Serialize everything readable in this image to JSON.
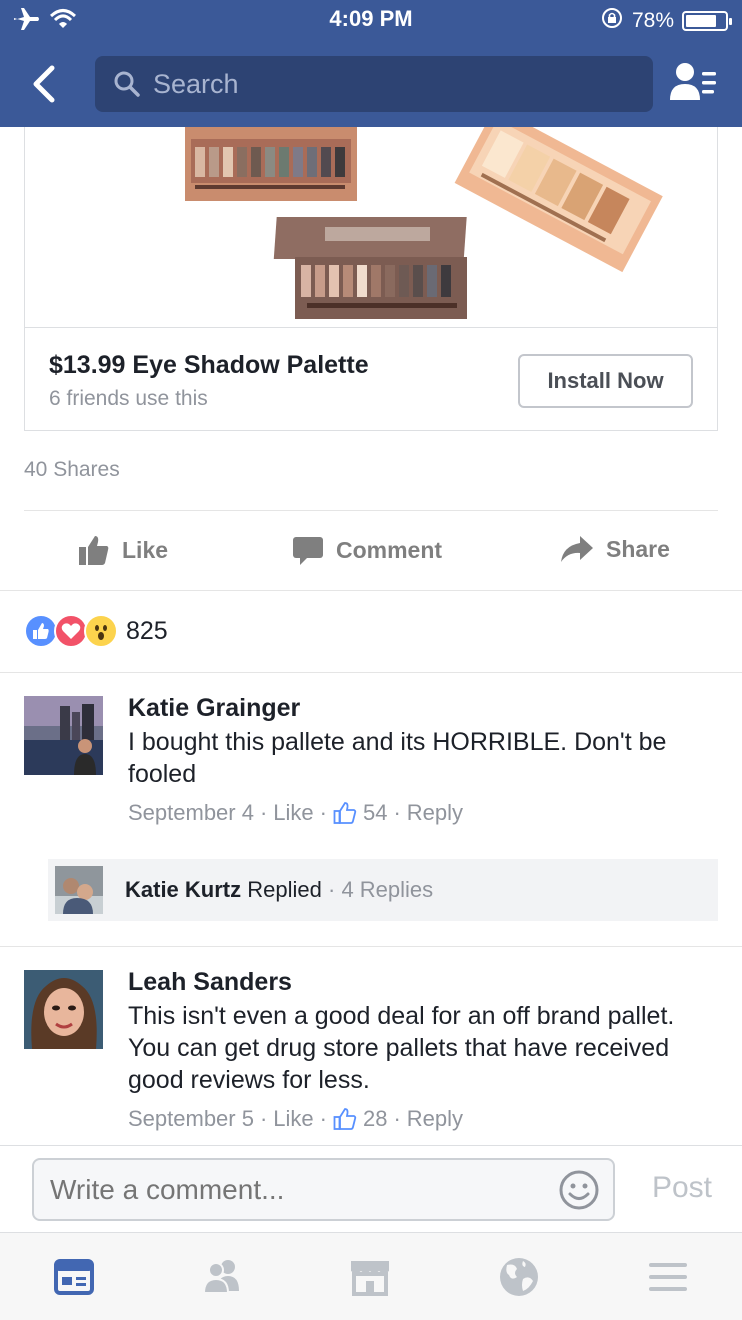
{
  "status_bar": {
    "time": "4:09 PM",
    "battery_percent": "78%",
    "battery_level": 0.78
  },
  "nav": {
    "search_placeholder": "Search"
  },
  "ad": {
    "title": "$13.99 Eye Shadow Palette",
    "subtitle": "6 friends use this",
    "install_label": "Install Now"
  },
  "post": {
    "shares": "40 Shares",
    "actions": {
      "like": "Like",
      "comment": "Comment",
      "share": "Share"
    },
    "reaction_count": "825"
  },
  "comments": [
    {
      "name": "Katie Grainger",
      "text": "I bought this pallete and its HORRIBLE. Don't be fooled",
      "date": "September 4",
      "like_label": "Like",
      "likes": "54",
      "reply_label": "Reply"
    },
    {
      "name": "Leah Sanders",
      "text": "This isn't even a good deal for an off brand pallet. You can get drug store pallets that have received good reviews for less.",
      "date": "September 5",
      "like_label": "Like",
      "likes": "28",
      "reply_label": "Reply"
    }
  ],
  "reply_thread": {
    "name": "Katie Kurtz",
    "action": "Replied",
    "count": "4 Replies"
  },
  "composer": {
    "placeholder": "Write a comment...",
    "post_label": "Post"
  },
  "colors": {
    "brand": "#3b5998",
    "like_blue": "#5890ff",
    "love_red": "#f25268",
    "wow_yellow": "#fcd34d",
    "active_tab": "#4267b2"
  }
}
